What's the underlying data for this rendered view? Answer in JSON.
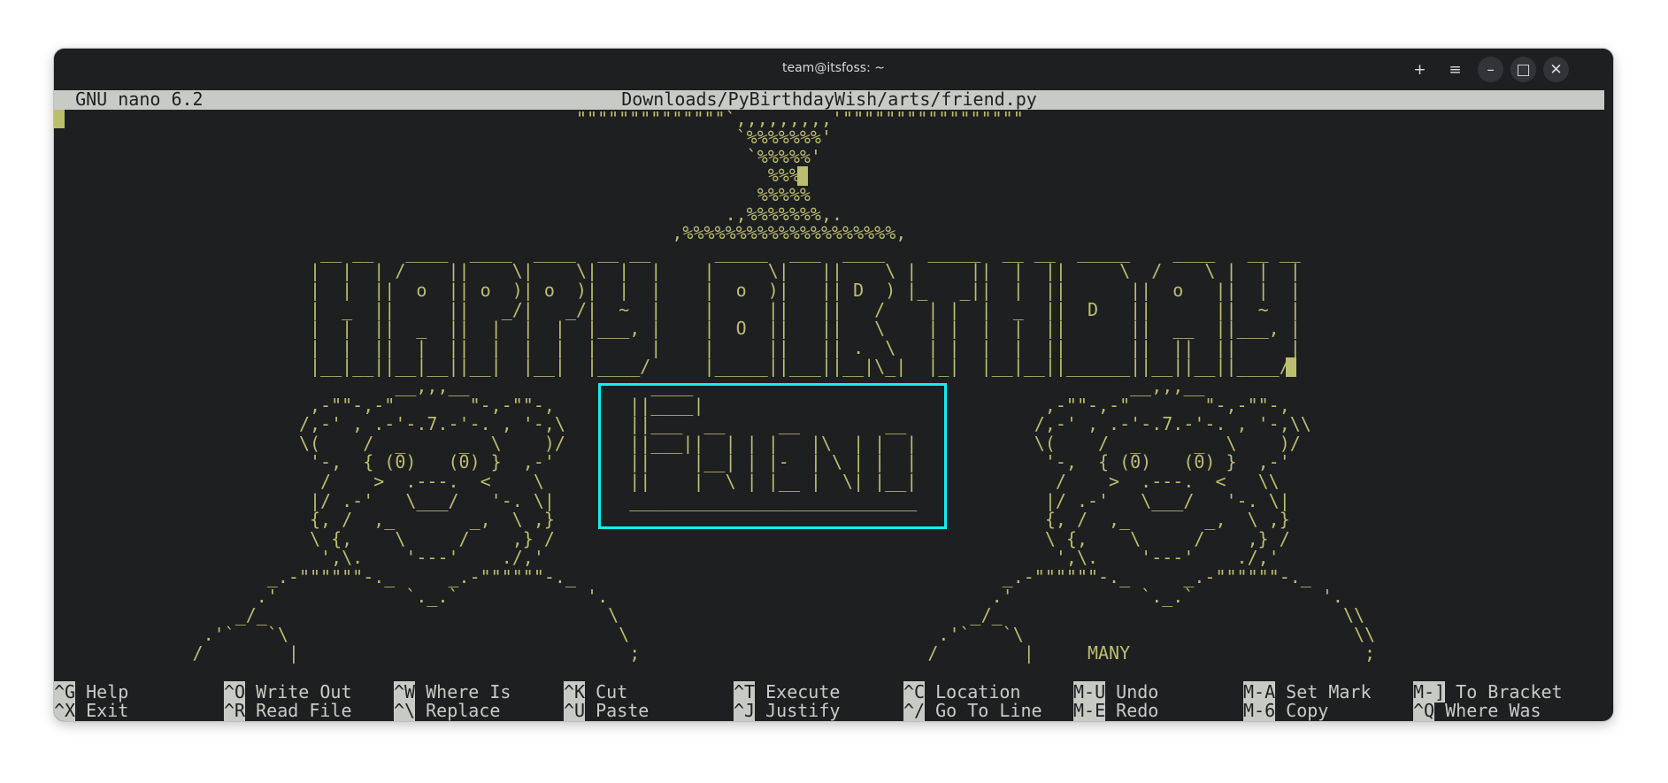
{
  "window": {
    "title": "team@itsfoss: ~",
    "buttons": {
      "new_tab": "+",
      "menu": "≡",
      "minimize": "–",
      "maximize": "□",
      "close": "✕"
    }
  },
  "nano": {
    "version_label": "  GNU nano 6.2",
    "file_path": "Downloads/PyBirthdayWish/arts/friend.py"
  },
  "editor": {
    "lines": [
      "                                                 \"\"\"\"\"\"\"\"\"\"\"\"\"\"`,,,,,,,,,'\"\"\"\"\"\"\"\"\"\"\"\"\"\"\"\"\"",
      "                                                                `%%%%%%%'",
      "                                                                 `%%%%%'",
      "                                                                   %%%",
      "                                                                  %%%%%",
      "                                                               .,%%%%%%%,.",
      "                                                          ,%%%%%%%%%%%%%%%%%%%%,",
      "                         __ __   ____  ____  ____  __ __      _____  ___  ____    _____  __ __  _____    ____   __ __ ",
      "                        |  |  | /    ||    \\|    \\|  |  |    |     \\|   ||    \\ |     ||  |  ||     \\  /    \\ |  |  |",
      "                        |  |  ||  o  || o  )| o  )|  |  |    |  o  )|   || D  ) |_   _||  |  ||      ||  o   ||  |  |",
      "                        |  _  ||     ||   _/|   _/|  ~  |    |     ||   ||   /    | |  |  _  ||  D   ||      ||  ~  |",
      "                        |  |  ||  _  ||  |  |  |  |___, |    |  O  ||   ||   \\    | |  |  |  ||      ||  __  ||___, |",
      "                        |  |  ||  |  ||  |  |  |  |     |    |     ||   || .  \\   | |  |  |  ||      ||  ||  ||     |",
      "                        |__|__||__|__||__|  |__|  |____/     |_____||___||__|\\_|  |_|  |__|__||______||__||__||____/ ",
      "                                __,,,__                 ____                                         __,,,__",
      "                        ,-\"\"-,-\"       \"-,-\"\"-,       ||____|                                ,-\"\"-,-\"       \"-,-\"\"-,",
      "                       /,-' , .-'-.7.-'-. , '-,\\      ||___  __     __        __            /,-' , .-'-.7.-'-. , '-,\\\\",
      "                       \\(    /  _     _  \\    )/      ||___||  | | |   |\\  | |  |           \\(    /  _     _  \\    )/",
      "                        '-,  { (0)   (0) }  ,-'       ||    |__| | |-  | \\ | |  |            '-,  { (0)   (0) }  ,-'",
      "                         /    >  .---.  <    \\        ||    |  \\ | |__ |  \\| |__|             /    >  .---.  <   \\\\",
      "                        |/ .-'   \\___/   '-. \\|       ___________________________            |/ .-'   \\___/   '-. \\|",
      "                        {, /  ,_       _,  \\ ,}                                              {, /  ,_       _,  \\ ,}",
      "                        \\ {,    \\     /    ,} /                                              \\ {,    \\     /    ,} /",
      "                         ',\\.    '---'    ./,'                                                ',\\.    '---'    ./,'",
      "                    _.-\"\"\"\"\"\"-._     _.-\"\"\"\"\"\"-._                                        _.-\"\"\"\"\"\"-._     _.-\"\"\"\"\"\"-._",
      "                   .'            `._.`            '.                                    .'            `._.`            '.",
      "                 _/_                                \\                                 _/_                                \\\\",
      "              .'`   `\\                               \\                             .'`   `\\                               \\\\",
      "             /        |                               ;                           /        |     MANY                      ;"
    ]
  },
  "shortcuts": [
    [
      {
        "key": "^G",
        "label": "Help"
      },
      {
        "key": "^O",
        "label": "Write Out"
      },
      {
        "key": "^W",
        "label": "Where Is"
      },
      {
        "key": "^K",
        "label": "Cut"
      },
      {
        "key": "^T",
        "label": "Execute"
      },
      {
        "key": "^C",
        "label": "Location"
      },
      {
        "key": "M-U",
        "label": "Undo"
      },
      {
        "key": "M-A",
        "label": "Set Mark"
      },
      {
        "key": "M-]",
        "label": "To Bracket"
      }
    ],
    [
      {
        "key": "^X",
        "label": "Exit"
      },
      {
        "key": "^R",
        "label": "Read File"
      },
      {
        "key": "^\\",
        "label": "Replace"
      },
      {
        "key": "^U",
        "label": "Paste"
      },
      {
        "key": "^J",
        "label": "Justify"
      },
      {
        "key": "^/",
        "label": "Go To Line"
      },
      {
        "key": "M-E",
        "label": "Redo"
      },
      {
        "key": "M-6",
        "label": "Copy"
      },
      {
        "key": "^Q",
        "label": "Where Was"
      }
    ]
  ],
  "colors": {
    "text": "#bcbe6e",
    "escape": "#a8d400",
    "highlight_box": "#10f0f0",
    "background": "#1e1f21",
    "bar": "#c8cac6"
  }
}
